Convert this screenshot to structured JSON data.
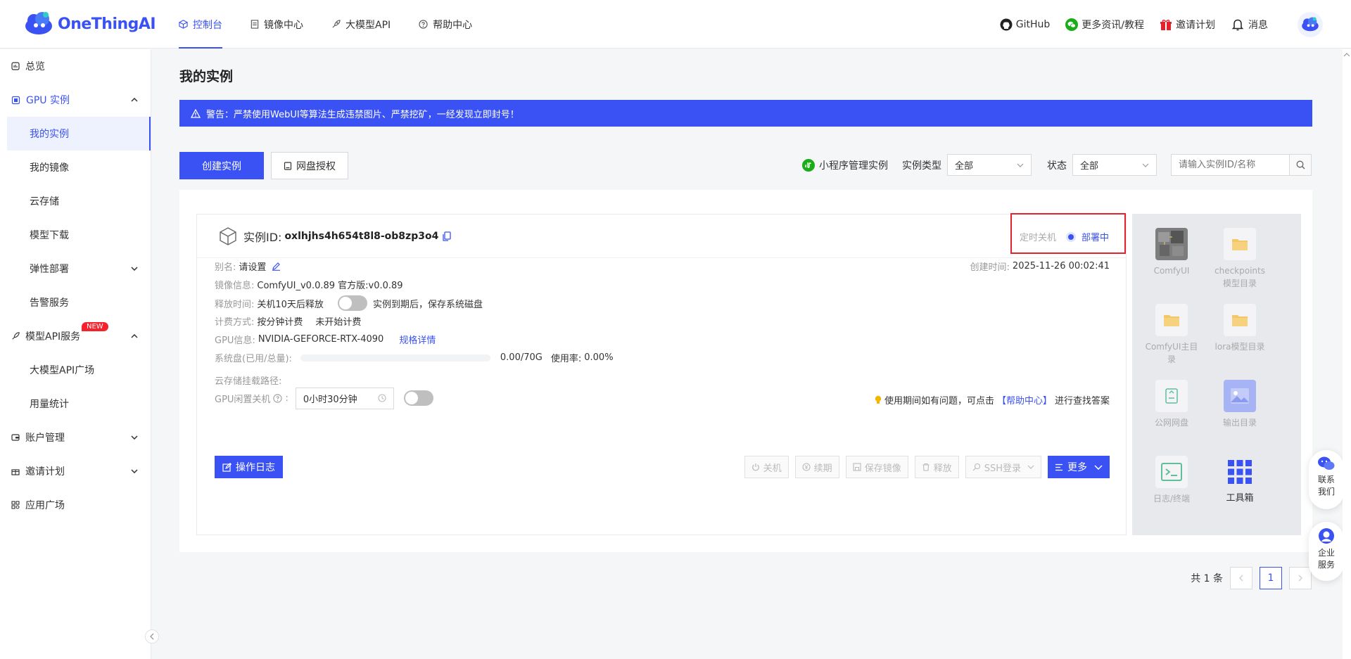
{
  "brand": {
    "name": "OneThingAI"
  },
  "nav": {
    "items": [
      {
        "label": "控制台",
        "icon": "cube-icon",
        "active": true
      },
      {
        "label": "镜像中心",
        "icon": "document-icon",
        "active": false
      },
      {
        "label": "大模型API",
        "icon": "rocket-icon",
        "active": false
      },
      {
        "label": "帮助中心",
        "icon": "help-circle-icon",
        "active": false
      }
    ]
  },
  "topright": {
    "github": "GitHub",
    "wechat": "更多资讯/教程",
    "invite": "邀请计划",
    "messages": "消息"
  },
  "sidebar": {
    "overview": "总览",
    "gpu": "GPU 实例",
    "gpu_children": [
      "我的实例",
      "我的镜像",
      "云存储",
      "模型下载",
      "弹性部署",
      "告警服务"
    ],
    "model_api": "模型API服务",
    "new_badge": "NEW",
    "model_api_children": [
      "大模型API广场",
      "用量统计"
    ],
    "account": "账户管理",
    "invite": "邀请计划",
    "apps": "应用广场"
  },
  "page": {
    "title": "我的实例",
    "warning": "警告：严禁使用WebUI等算法生成违禁图片、严禁挖矿，一经发现立即封号！"
  },
  "toolbar": {
    "create": "创建实例",
    "disk_auth": "网盘授权",
    "mini_program": "小程序管理实例",
    "type_label": "实例类型",
    "type_value": "全部",
    "status_label": "状态",
    "status_value": "全部",
    "search_placeholder": "请输入实例ID/名称"
  },
  "instance": {
    "id_label": "实例ID:",
    "id": "oxlhjhs4h654t8l8-ob8zp3o4",
    "timer_label": "定时关机",
    "status": "部署中",
    "alias_label": "别名:",
    "alias": "请设置",
    "created_label": "创建时间:",
    "created": "2025-11-26 00:02:41",
    "image_label": "镜像信息:",
    "image": "ComfyUI_v0.0.89 官方版:v0.0.89",
    "release_label": "释放时间:",
    "release": "关机10天后释放",
    "release_toggle_text": "实例到期后，保存系统磁盘",
    "billing_label": "计费方式:",
    "billing": "按分钟计费",
    "billing_state": "未开始计费",
    "gpu_label": "GPU信息:",
    "gpu": "NVIDIA-GEFORCE-RTX-4090",
    "gpu_spec_link": "规格详情",
    "disk_label": "系统盘(已用/总量):",
    "disk_value": "0.00/70G",
    "disk_usage_label": "使用率:",
    "disk_usage": "0.00%",
    "disk_usage_fraction": 0,
    "cloud_mount_label": "云存储挂载路径:",
    "idle_label": "GPU闲置关机",
    "idle_value": "0小时30分钟",
    "help_text_pre": "使用期间如有问题，可点击",
    "help_link": "【帮助中心】",
    "help_text_post": "进行查找答案",
    "log_btn": "操作日志",
    "actions": [
      "关机",
      "续期",
      "保存镜像",
      "释放",
      "SSH登录"
    ],
    "more": "更多"
  },
  "tools": [
    {
      "label": "ComfyUI",
      "icon": "comfyui-icon"
    },
    {
      "label": "checkpoints模型目录",
      "icon": "folder-icon"
    },
    {
      "label": "ComfyUI主目录",
      "icon": "folder-icon"
    },
    {
      "label": "lora模型目录",
      "icon": "folder-icon"
    },
    {
      "label": "公网网盘",
      "icon": "disk-icon"
    },
    {
      "label": "输出目录",
      "icon": "image-icon"
    },
    {
      "label": "日志/终端",
      "icon": "terminal-icon"
    },
    {
      "label": "工具箱",
      "icon": "grid-icon"
    }
  ],
  "pager": {
    "total": "共 1 条",
    "current": "1"
  },
  "floats": {
    "contact": "联系我们",
    "enterprise": "企业服务"
  },
  "colors": {
    "accent": "#3a52f4",
    "danger": "#e4222f"
  }
}
